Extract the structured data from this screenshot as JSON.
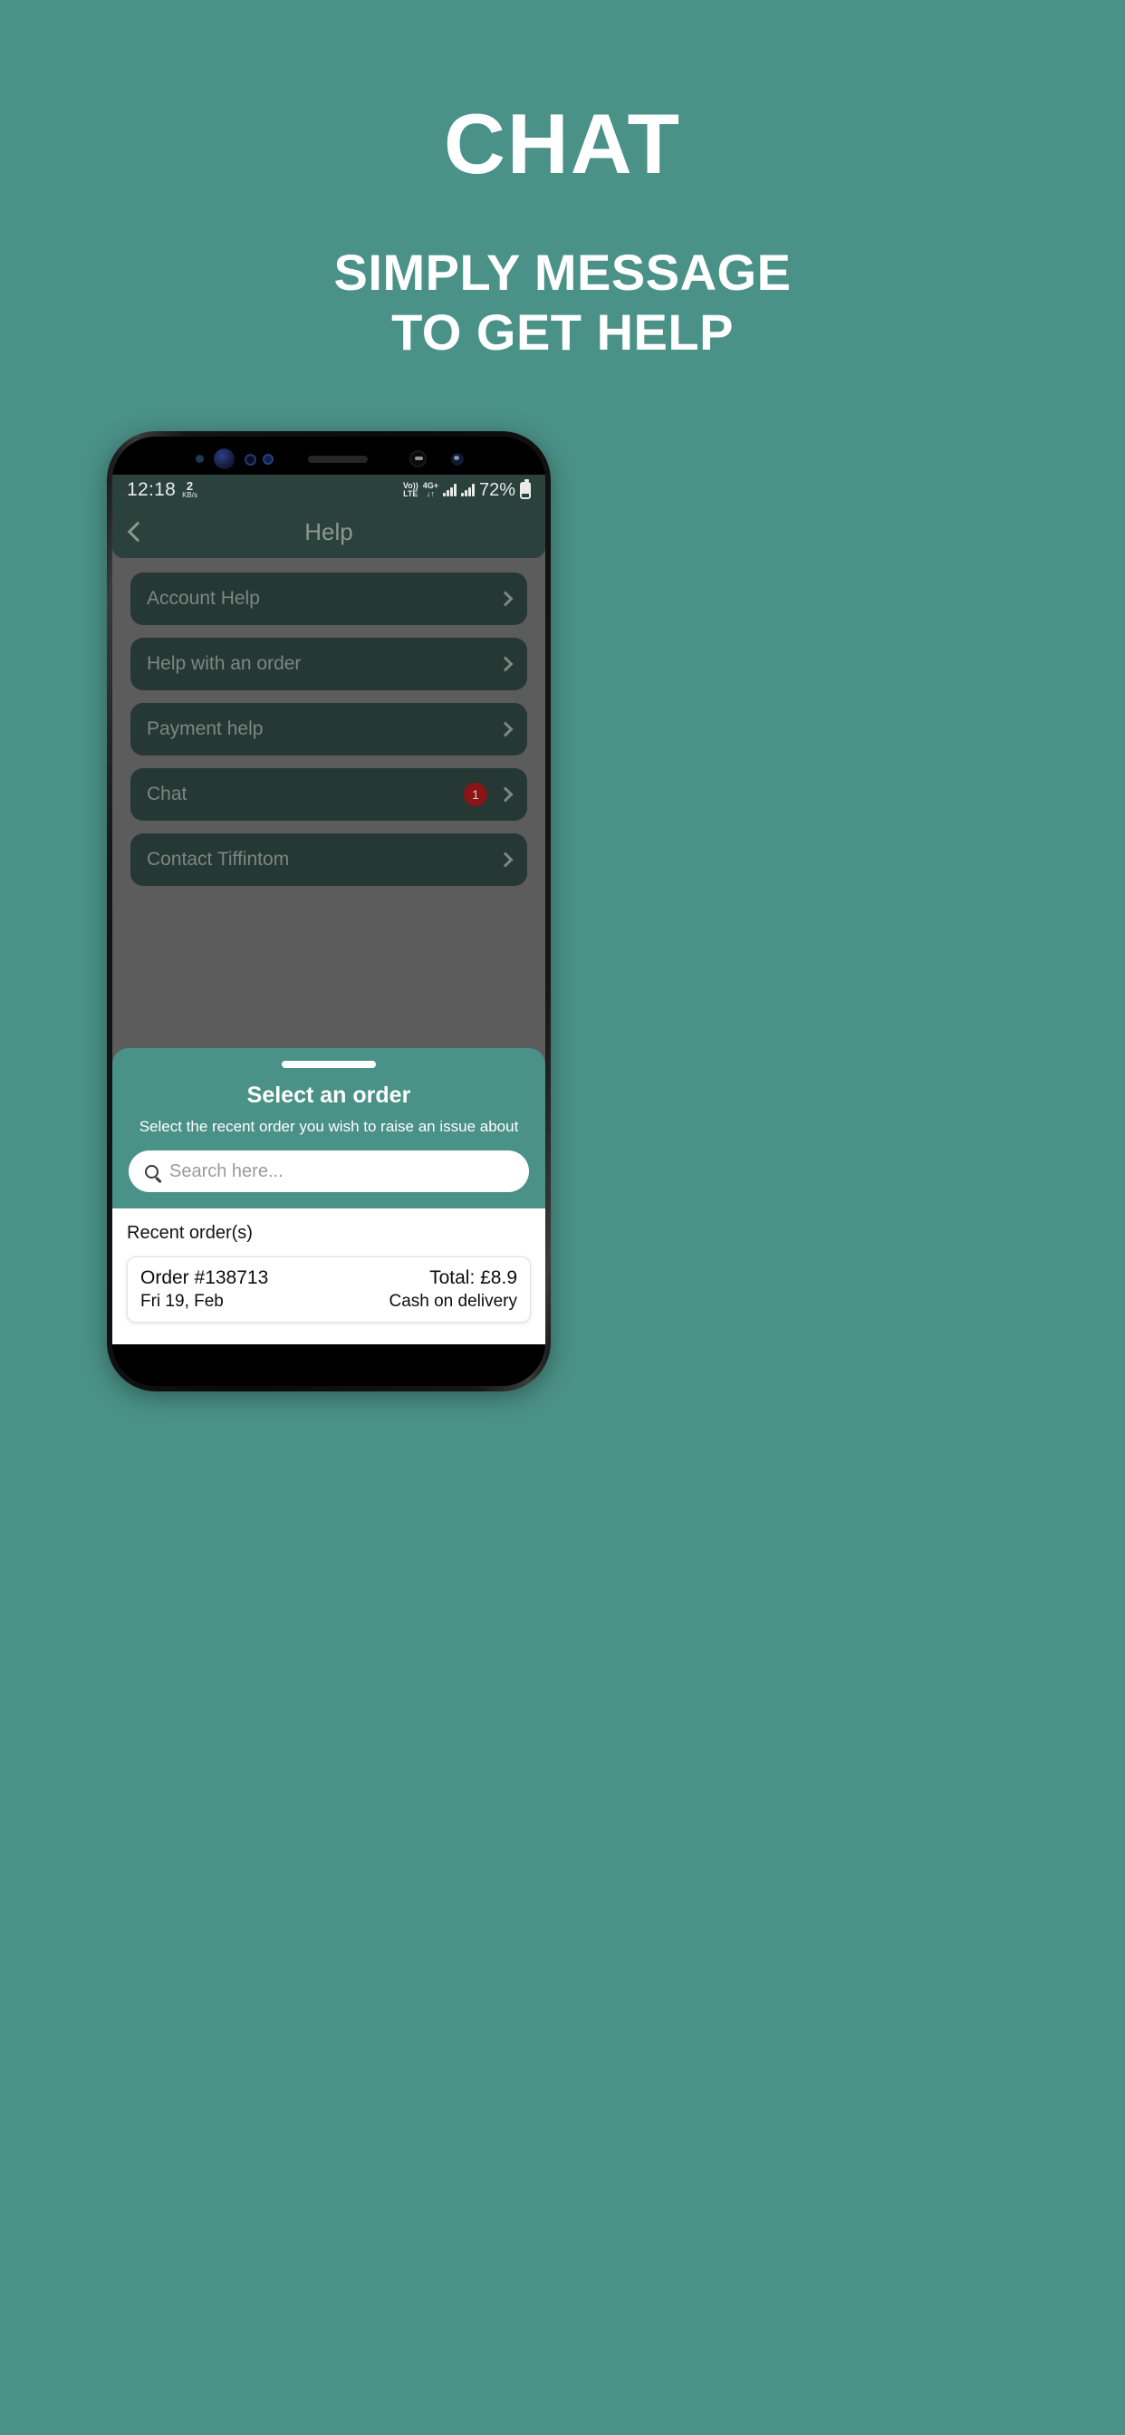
{
  "promo": {
    "title": "CHAT",
    "subtitle_line1": "SIMPLY MESSAGE",
    "subtitle_line2": "TO GET HELP"
  },
  "colors": {
    "background_teal": "#4a9187",
    "card_dark_green": "#263833",
    "header_dark_green": "#2b413b",
    "dimmed_overlay": "#5c5c5c",
    "badge_red": "#8b1416",
    "white": "#ffffff"
  },
  "phone": {
    "status_bar": {
      "time": "12:18",
      "net_speed_value": "2",
      "net_speed_unit": "KB/s",
      "volte_top": "Vo))",
      "volte_bottom": "LTE",
      "network_top": "4G+",
      "network_bottom": "↓↑",
      "battery_percent": "72%"
    },
    "nav": {
      "back_icon": "chevron-left-icon",
      "title": "Help"
    },
    "help_items": [
      {
        "label": "Account Help",
        "badge": ""
      },
      {
        "label": "Help with an order",
        "badge": ""
      },
      {
        "label": "Payment help",
        "badge": ""
      },
      {
        "label": "Chat",
        "badge": "1"
      },
      {
        "label": "Contact Tiffintom",
        "badge": ""
      }
    ],
    "sheet": {
      "title": "Select an order",
      "subtitle": "Select the recent order you wish to raise an issue about",
      "search_placeholder": "Search here...",
      "search_value": "",
      "search_icon": "search-icon",
      "orders_header": "Recent order(s)",
      "orders": [
        {
          "order_id": "Order #138713",
          "date": "Fri 19, Feb",
          "total": "Total: £8.9",
          "payment": "Cash on delivery"
        }
      ]
    }
  }
}
